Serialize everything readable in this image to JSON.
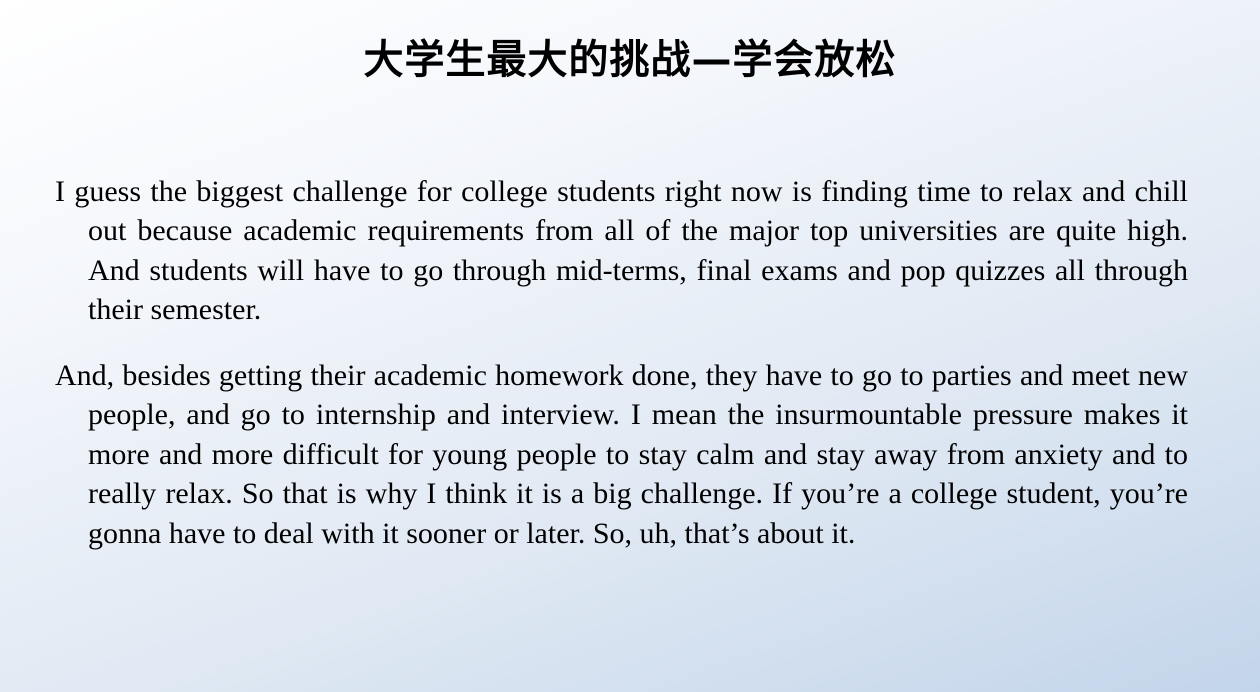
{
  "slide": {
    "title": "大学生最大的挑战—学会放松",
    "paragraphs": [
      "I guess the biggest challenge for college students right now is finding time to relax and chill out because academic requirements from all of the major top universities are quite high. And students will have to go through mid-terms, final exams and pop quizzes all through their semester.",
      "And, besides getting their academic homework done, they have to go to parties and meet new people, and go to internship and interview. I mean the insurmountable pressure makes it more and more difficult for young people to stay calm and stay away from anxiety and to really relax.   So that is why I think it is a big challenge. If you’re a college student, you’re gonna have to deal with it sooner or later. So, uh, that’s about it."
    ]
  }
}
